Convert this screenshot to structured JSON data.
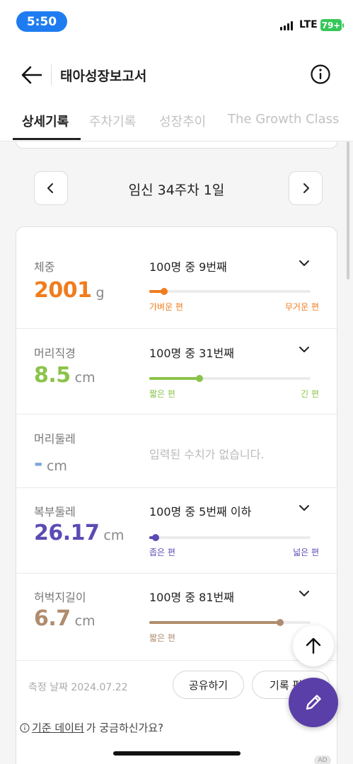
{
  "status_bar": {
    "time": "5:50",
    "network": "LTE",
    "battery": "79+"
  },
  "header": {
    "title": "태아성장보고서",
    "back_icon": "arrow-left-icon",
    "info_icon": "info-circle-icon"
  },
  "tabs": [
    {
      "label": "상세기록",
      "active": true
    },
    {
      "label": "주차기록",
      "active": false
    },
    {
      "label": "성장추이",
      "active": false
    },
    {
      "label": "The Growth Class",
      "active": false
    }
  ],
  "week_nav": {
    "label": "임신 34주차 1일"
  },
  "metrics": [
    {
      "label": "체중",
      "value": "2001",
      "unit": "g",
      "rank": "100명 중 9번째",
      "left_label": "가벼운 편",
      "right_label": "무거운 편",
      "percentile": 0.09,
      "color": "#f07c1e"
    },
    {
      "label": "머리직경",
      "value": "8.5",
      "unit": "cm",
      "rank": "100명 중 31번째",
      "left_label": "짧은 편",
      "right_label": "긴 편",
      "percentile": 0.31,
      "color": "#8bc34a"
    },
    {
      "label": "머리둘레",
      "value": "-",
      "unit": "cm",
      "empty_message": "입력된 수치가 없습니다.",
      "color": "#7ba7d6"
    },
    {
      "label": "복부둘레",
      "value": "26.17",
      "unit": "cm",
      "rank": "100명 중 5번째 이하",
      "left_label": "좁은 편",
      "right_label": "넓은 편",
      "percentile": 0.04,
      "color": "#5b4bb4"
    },
    {
      "label": "허벅지길이",
      "value": "6.7",
      "unit": "cm",
      "rank": "100명 중 81번째",
      "left_label": "짧은 편",
      "right_label": "",
      "percentile": 0.81,
      "color": "#b08c6e"
    }
  ],
  "footer": {
    "measure_date": "측정 날짜 2024.07.22",
    "share_label": "공유하기",
    "record_label": "기록 편집"
  },
  "help": {
    "link_text": "기준 데이터",
    "suffix_text": "가 궁금하신가요?"
  },
  "ad_badge": "AD"
}
